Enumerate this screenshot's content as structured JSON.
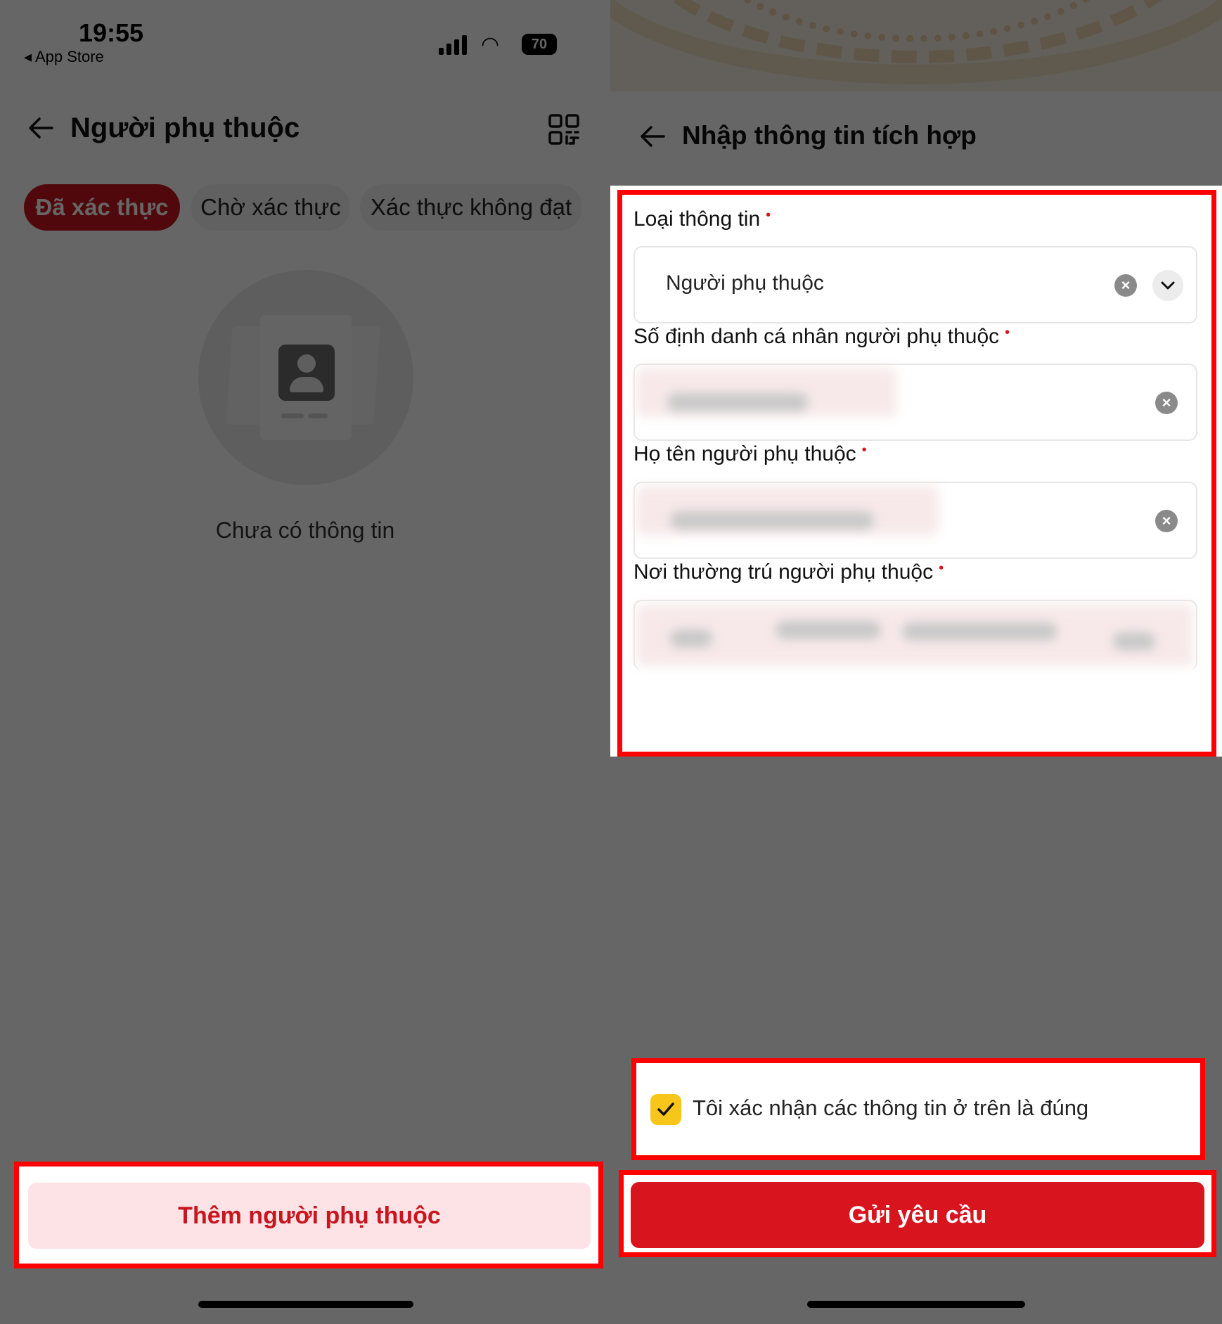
{
  "left_screen": {
    "status_bar": {
      "time": "19:55",
      "back_app": "◂ App Store",
      "battery": "70"
    },
    "header": {
      "title": "Người phụ thuộc",
      "back_icon": "arrow-left-icon",
      "qr_icon": "qr-scan-icon"
    },
    "tabs": [
      {
        "label": "Đã xác thực",
        "active": true
      },
      {
        "label": "Chờ xác thực",
        "active": false
      },
      {
        "label": "Xác thực không đạt",
        "active": false
      }
    ],
    "empty_state": {
      "icon": "id-card-icon",
      "text": "Chưa có thông tin"
    },
    "add_button": {
      "label": "Thêm người phụ thuộc"
    }
  },
  "right_screen": {
    "header": {
      "title": "Nhập thông tin tích hợp",
      "back_icon": "arrow-left-icon"
    },
    "form": {
      "info_type": {
        "label": "Loại thông tin",
        "required": "•",
        "value": "Người phụ thuộc"
      },
      "personal_id": {
        "label": "Số định danh cá nhân người phụ thuộc",
        "required": "•"
      },
      "full_name": {
        "label": "Họ tên người phụ thuộc",
        "required": "•"
      },
      "permanent_address": {
        "label": "Nơi thường trú người phụ thuộc",
        "required": "•"
      }
    },
    "confirm": {
      "checked": true,
      "text": "Tôi xác nhận các thông tin ở trên là đúng"
    },
    "submit_button": {
      "label": "Gửi yêu cầu"
    }
  },
  "colors": {
    "primary_red": "#d8141e",
    "tab_active": "#c8151e",
    "add_button_bg": "#fde3e6",
    "checkbox_yellow": "#f8c61a",
    "highlight_border": "#ff0000"
  }
}
